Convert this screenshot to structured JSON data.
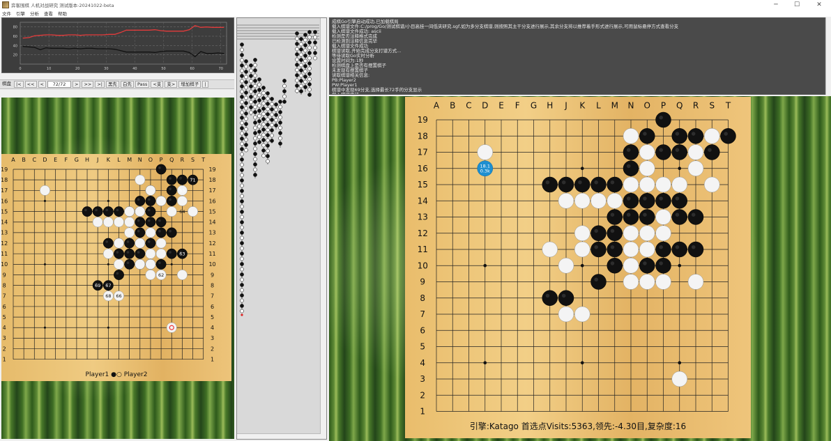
{
  "window": {
    "title": "弈客围棋 人机对战研究 测试版本-20241022-beta",
    "minimize": "─",
    "maximize": "☐",
    "close": "✕"
  },
  "menu": [
    "文件",
    "引擎",
    "分析",
    "查看",
    "帮助"
  ],
  "winrate_chart": {
    "chart_data": {
      "type": "line",
      "x_ticks": [
        "0",
        "10",
        "20",
        "30",
        "40",
        "50",
        "60",
        "70"
      ],
      "y_ticks": [
        "20",
        "40",
        "60",
        "80"
      ],
      "xlim": [
        0,
        72
      ],
      "ylim": [
        0,
        90
      ],
      "grid": true,
      "series": [
        {
          "color": "#e23b3b",
          "x": [
            1,
            3,
            5,
            7,
            9,
            11,
            13,
            15,
            17,
            19,
            21,
            23,
            25,
            27,
            29,
            31,
            33,
            35,
            37,
            39,
            41,
            43,
            45,
            47,
            49,
            51,
            53,
            55,
            57,
            59,
            61,
            63,
            65,
            67,
            69,
            71
          ],
          "values": [
            56,
            57,
            61,
            62,
            63,
            63,
            62,
            62,
            63,
            63,
            62,
            63,
            63,
            63,
            63,
            64,
            64,
            68,
            73,
            73,
            73,
            73,
            73,
            74,
            72,
            71,
            71,
            71,
            71,
            74,
            83,
            79,
            80,
            79,
            79,
            79
          ]
        },
        {
          "color": "#111111",
          "x": [
            1,
            3,
            5,
            7,
            9,
            11,
            13,
            15,
            17,
            19,
            21,
            23,
            25,
            27,
            29,
            31,
            33,
            35,
            37,
            39,
            41,
            43,
            45,
            47,
            49,
            51,
            53,
            55,
            57,
            59,
            61,
            63,
            65,
            67,
            69,
            71
          ],
          "values": [
            38,
            37,
            36,
            31,
            35,
            34,
            34,
            34,
            33,
            34,
            33,
            34,
            34,
            33,
            33,
            33,
            32,
            29,
            26,
            26,
            26,
            26,
            26,
            25,
            27,
            28,
            28,
            28,
            28,
            25,
            16,
            27,
            23,
            23,
            24,
            23
          ]
        }
      ]
    }
  },
  "toolbar": {
    "label": "棋盘",
    "nav": [
      "|<",
      "<<",
      "<"
    ],
    "move_counter": "72/72",
    "nav2": [
      ">",
      ">>",
      ">|"
    ],
    "buttons": [
      "黑先",
      "白先",
      "Pass",
      "<支",
      "支>",
      "增加棋子",
      "|"
    ]
  },
  "board_cols": [
    "A",
    "B",
    "C",
    "D",
    "E",
    "F",
    "G",
    "H",
    "J",
    "K",
    "L",
    "M",
    "N",
    "O",
    "P",
    "Q",
    "R",
    "S",
    "T"
  ],
  "board_rows": [
    "19",
    "18",
    "17",
    "16",
    "15",
    "14",
    "13",
    "12",
    "11",
    "10",
    "9",
    "8",
    "7",
    "6",
    "5",
    "4",
    "3",
    "2",
    "1"
  ],
  "left_board": {
    "players": "Player1 ●○ Player2",
    "black": [
      "P19",
      "Q18",
      "R18",
      "S18",
      "O17",
      "Q17",
      "N16",
      "O16",
      "P16",
      "Q16",
      "H15",
      "J15",
      "K15",
      "L15",
      "M15",
      "N15",
      "O15",
      "N14",
      "O14",
      "P14",
      "N13",
      "O13",
      "P13",
      "Q13",
      "K12",
      "L12",
      "M12",
      "N12",
      "O12",
      "L11",
      "M11",
      "N11",
      "Q11",
      "R11",
      "M10",
      "N10",
      "O10",
      "P10",
      "L9",
      "J8",
      "K8"
    ],
    "white": [
      "D17",
      "N18",
      "O17",
      "R17",
      "P16",
      "R16",
      "M15",
      "N15a",
      "Q15",
      "S15",
      "J14",
      "K14",
      "L14",
      "M14",
      "M13",
      "O13a",
      "L12a",
      "N12a",
      "P12",
      "O11",
      "P11",
      "K11",
      "L10",
      "N10a",
      "O10a",
      "O9",
      "P9",
      "R9",
      "K7",
      "L7",
      "Q4"
    ],
    "labels": [
      {
        "pt": "R18",
        "text": "70",
        "color": "white"
      },
      {
        "pt": "S18",
        "text": "71",
        "color": "black"
      },
      {
        "pt": "R17",
        "text": "65",
        "color": "black"
      },
      {
        "pt": "R15",
        "text": "64",
        "color": "white"
      },
      {
        "pt": "R11",
        "text": "63",
        "color": "black"
      },
      {
        "pt": "P9",
        "text": "62",
        "color": "white"
      },
      {
        "pt": "J8",
        "text": "69",
        "color": "black"
      },
      {
        "pt": "K8",
        "text": "67",
        "color": "black"
      },
      {
        "pt": "K7",
        "text": "68",
        "color": "white"
      },
      {
        "pt": "L7",
        "text": "66",
        "color": "white"
      }
    ]
  },
  "console": {
    "lines": [
      "成棋Go引擎启动成功,已加载棋局",
      "载入棋谱文件:C:/prog/Go/测试棋谱/小目高挂一间低夹研究.sgf,如为多分支棋谱,则按照其主干分支进行展示,其余分支将以推荐着手形式进行展示,可用鼠标悬停方式查看分支",
      "载入棋谱文件成功: ascii",
      "检测是否注释格式完成",
      "已检测到注释信息完毕",
      "载入棋谱文件成功",
      "棋谱读取,开始完成分支打谱方式...",
      "等待读取Go实时分析",
      "设置时间为:1秒",
      "检测棋盘上是否有摆置棋子",
      "未发现有摆置棋子",
      "读取棋谱相关信息:",
      "PB:Player2",
      "PW:Player1",
      "棋谱中发现69分支,选择最长72手的分支显示",
      "载入棋谱完毕"
    ]
  },
  "right_board": {
    "black": [
      "P19",
      "O18",
      "Q18",
      "R18",
      "T18",
      "N17",
      "P17",
      "Q17",
      "S17",
      "N16",
      "H15",
      "J15",
      "K15",
      "L15",
      "M15",
      "N14",
      "O14",
      "P14",
      "Q14",
      "M13",
      "N13",
      "O13",
      "Q13",
      "R13",
      "L12",
      "M12",
      "L11",
      "M11",
      "P11",
      "Q11",
      "R11",
      "M10",
      "O10",
      "P10",
      "L9",
      "H8",
      "J8"
    ],
    "white": [
      "D17",
      "N18",
      "S18",
      "O17",
      "R17",
      "O16",
      "R16",
      "N15",
      "O15",
      "P15",
      "Q15",
      "S15",
      "J14",
      "K14",
      "L14",
      "M14",
      "P13",
      "K12",
      "N12",
      "O12",
      "P12",
      "H11",
      "K11",
      "N11",
      "O11",
      "J10",
      "N10",
      "N9",
      "O9",
      "P9",
      "R9",
      "J7",
      "K7",
      "Q3"
    ],
    "suggestion": {
      "pt": "D16",
      "line1": "18.1",
      "line2": "0.3k"
    },
    "status": "引擎:Katago 首选点Visits:5363,领先:-4.30目,复杂度:16"
  },
  "colors": {
    "suggestion": "#1e8fd0",
    "line_red": "#e23b3b",
    "console_bg": "#4a4a4a"
  }
}
